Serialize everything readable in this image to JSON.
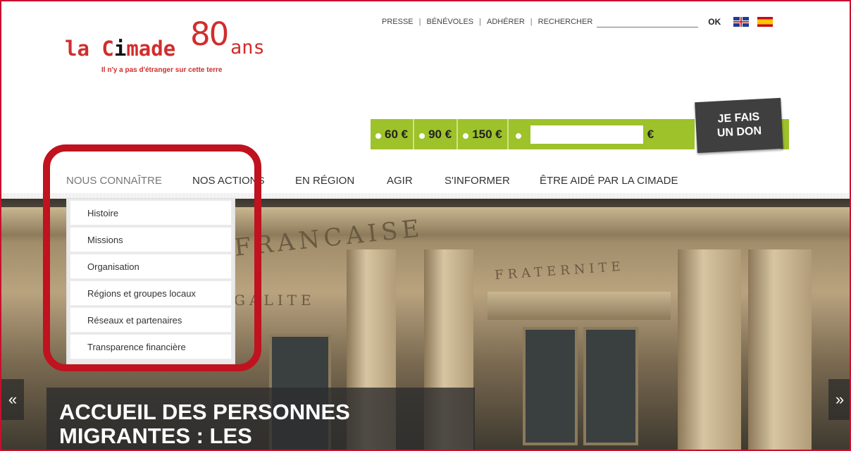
{
  "logo": {
    "brand_prefix": "la ",
    "brand_c": "C",
    "brand_i": "i",
    "brand_rest": "made",
    "anniversary_number": "80",
    "anniversary_word": "ans",
    "tagline": "Il n'y a pas d'étranger sur cette terre"
  },
  "topnav": {
    "items": [
      "PRESSE",
      "BÉNÉVOLES",
      "ADHÉRER",
      "RECHERCHER"
    ],
    "separator": "|",
    "search_value": "",
    "ok_label": "OK",
    "flags": [
      "uk-flag-icon",
      "spain-flag-icon"
    ]
  },
  "donation": {
    "amounts": [
      "60 €",
      "90 €",
      "150 €"
    ],
    "custom_value": "",
    "currency": "€",
    "button_line1": "JE FAIS",
    "button_line2": "UN DON",
    "color": "#9dc22a",
    "button_color": "#3f3f3f"
  },
  "mainnav": {
    "items": [
      "NOUS CONNAÎTRE",
      "NOS ACTIONS",
      "EN RÉGION",
      "AGIR",
      "S'INFORMER",
      "ÊTRE AIDÉ PAR LA CIMADE"
    ],
    "active_index": 0
  },
  "dropdown": {
    "items": [
      "Histoire",
      "Missions",
      "Organisation",
      "Régions et groupes locaux",
      "Réseaux et partenaires",
      "Transparence financière"
    ]
  },
  "hero": {
    "engraving_main": "FRANCAISE",
    "engraving_left": "GALITE",
    "engraving_right": "FRATERNITE",
    "caption_line1": "ACCUEIL DES PERSONNES",
    "caption_line2": "MIGRANTES : LES",
    "prev_arrow": "«",
    "next_arrow": "»"
  },
  "colors": {
    "brand_red": "#d12d2d",
    "highlight_red": "#c0121f"
  }
}
